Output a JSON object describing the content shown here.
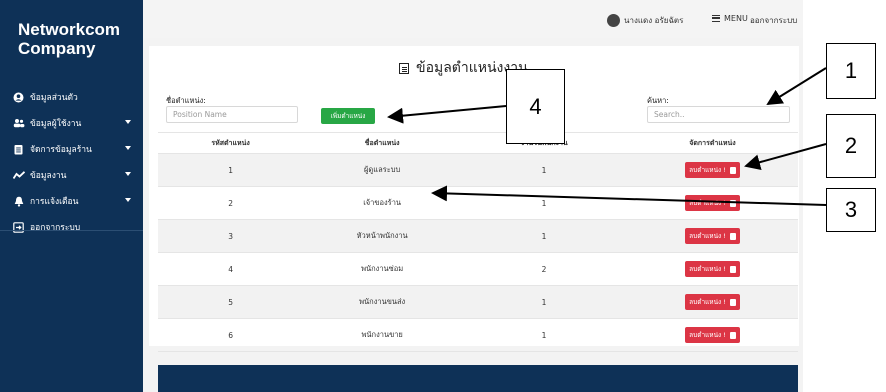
{
  "sidebar": {
    "brand": "Networkcom Company",
    "items": [
      {
        "label": "ข้อมูลส่วนตัว",
        "icon": "user-circle-icon",
        "caret": false
      },
      {
        "label": "ข้อมูลผู้ใช้งาน",
        "icon": "users-icon",
        "caret": true
      },
      {
        "label": "จัดการข้อมูลร้าน",
        "icon": "clipboard-icon",
        "caret": true
      },
      {
        "label": "ข้อมูลงาน",
        "icon": "chart-line-icon",
        "caret": true
      },
      {
        "label": "การแจ้งเตือน",
        "icon": "bell-icon",
        "caret": true
      },
      {
        "label": "ออกจากระบบ",
        "icon": "sign-out-icon",
        "caret": false
      }
    ]
  },
  "topbar": {
    "user_name": "นางแดง อรัยฉัตร",
    "menu_label": "MENU",
    "logout_label": "ออกจากระบบ"
  },
  "page": {
    "title": "ข้อมูลตำแหน่งงาน",
    "position_name_label": "ชื่อตำแหน่ง:",
    "position_name_placeholder": "Position Name",
    "add_button_label": "เพิ่มตำแหน่ง",
    "search_label": "ค้นหา:",
    "search_placeholder": "Search.."
  },
  "table": {
    "headers": [
      "รหัสตำแหน่ง",
      "ชื่อตำแหน่ง",
      "จำนวนพนักงาน",
      "จัดการตำแหน่ง"
    ],
    "delete_label": "ลบตำแหน่ง !",
    "rows": [
      {
        "id": "1",
        "name": "ผู้ดูแลระบบ",
        "count": "1"
      },
      {
        "id": "2",
        "name": "เจ้าของร้าน",
        "count": "1"
      },
      {
        "id": "3",
        "name": "หัวหน้าพนักงาน",
        "count": "1"
      },
      {
        "id": "4",
        "name": "พนักงานซ่อม",
        "count": "2"
      },
      {
        "id": "5",
        "name": "พนักงานขนส่ง",
        "count": "1"
      },
      {
        "id": "6",
        "name": "พนักงานขาย",
        "count": "1"
      }
    ]
  },
  "annotations": [
    "1",
    "2",
    "3",
    "4"
  ],
  "colors": {
    "sidebar_bg": "#0e3157",
    "add_button": "#28a745",
    "delete_button": "#dc3545"
  }
}
